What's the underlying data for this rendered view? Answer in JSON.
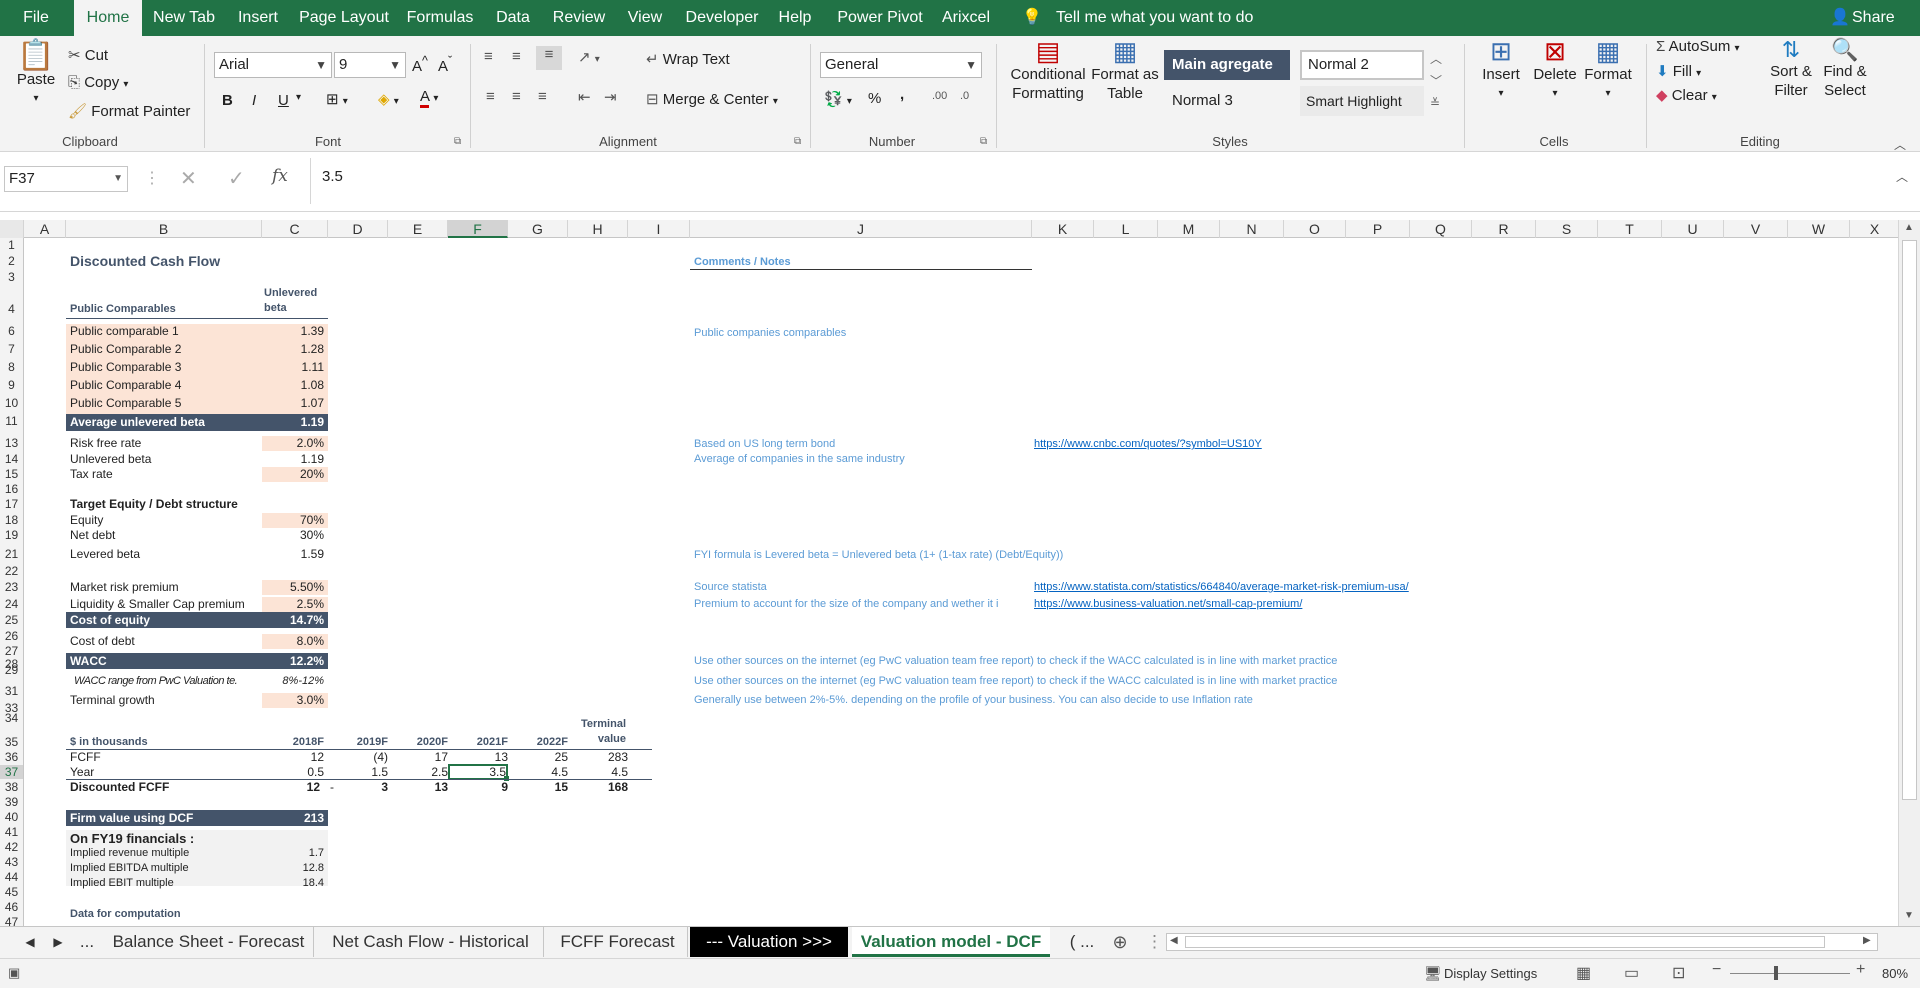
{
  "ribbon_tabs": [
    "File",
    "Home",
    "New Tab",
    "Insert",
    "Page Layout",
    "Formulas",
    "Data",
    "Review",
    "View",
    "Developer",
    "Help",
    "Power Pivot",
    "Arixcel"
  ],
  "tell_me": "Tell me what you want to do",
  "share": "Share",
  "clipboard": {
    "paste": "Paste",
    "cut": "Cut",
    "copy": "Copy",
    "format_painter": "Format Painter",
    "label": "Clipboard"
  },
  "font": {
    "name": "Arial",
    "size": "9",
    "label": "Font",
    "bold": "B",
    "italic": "I",
    "underline": "U"
  },
  "alignment": {
    "wrap": "Wrap Text",
    "merge": "Merge & Center",
    "label": "Alignment"
  },
  "number": {
    "format": "General",
    "label": "Number",
    "percent": "%",
    "comma": ","
  },
  "styles": {
    "cond_fmt": "Conditional Formatting",
    "format_table": "Format as Table",
    "label": "Styles",
    "s1": "Main agregate",
    "s2": "Normal 2",
    "s3": "Normal 3",
    "s4": "Smart Highlight"
  },
  "cells": {
    "insert": "Insert",
    "delete": "Delete",
    "format": "Format",
    "label": "Cells"
  },
  "editing": {
    "autosum": "AutoSum",
    "fill": "Fill",
    "clear": "Clear",
    "sort": "Sort & Filter",
    "find": "Find & Select",
    "label": "Editing"
  },
  "formula_bar": {
    "name_box": "F37",
    "value": "3.5",
    "fx": "fx"
  },
  "columns": [
    "A",
    "B",
    "C",
    "D",
    "E",
    "F",
    "G",
    "H",
    "I",
    "J",
    "K",
    "L",
    "M",
    "N",
    "O",
    "P",
    "Q",
    "R",
    "S",
    "T",
    "U",
    "V",
    "W",
    "X"
  ],
  "selected_column": "F",
  "rows": [
    "1",
    "2",
    "3",
    "4",
    "6",
    "7",
    "8",
    "9",
    "10",
    "11",
    "13",
    "14",
    "15",
    "16",
    "17",
    "18",
    "19",
    "21",
    "22",
    "23",
    "24",
    "25",
    "26",
    "27",
    "28",
    "29",
    "31",
    "33",
    "34",
    "35",
    "36",
    "37",
    "38",
    "39",
    "40",
    "41",
    "42",
    "43",
    "44",
    "45",
    "46",
    "47"
  ],
  "selected_row": "37",
  "sheet": {
    "title": "Discounted Cash Flow",
    "comments_header": "Comments / Notes",
    "unlevered_header": "Unlevered beta",
    "public_comparables": "Public Comparables",
    "comparables": [
      {
        "name": "Public comparable 1",
        "beta": "1.39"
      },
      {
        "name": "Public Comparable 2",
        "beta": "1.28"
      },
      {
        "name": "Public Comparable 3",
        "beta": "1.11"
      },
      {
        "name": "Public Comparable 4",
        "beta": "1.08"
      },
      {
        "name": "Public Comparable 5",
        "beta": "1.07"
      }
    ],
    "avg_beta_label": "Average unlevered beta",
    "avg_beta": "1.19",
    "risk_free_label": "Risk free rate",
    "risk_free": "2.0%",
    "unlevered_beta_label": "Unlevered beta",
    "unlevered_beta": "1.19",
    "tax_label": "Tax rate",
    "tax": "20%",
    "target_structure": "Target Equity / Debt structure",
    "equity_label": "Equity",
    "equity": "70%",
    "net_debt_label": "Net debt",
    "net_debt": "30%",
    "levered_beta_label": "Levered beta",
    "levered_beta": "1.59",
    "mrp_label": "Market risk premium",
    "mrp": "5.50%",
    "liq_label": "Liquidity & Smaller Cap premium",
    "liq": "2.5%",
    "coe_label": "Cost of equity",
    "coe": "14.7%",
    "cod_label": "Cost of debt",
    "cod": "8.0%",
    "wacc_label": "WACC",
    "wacc": "12.2%",
    "wacc_range_label": "WACC range from PwC Valuation te.",
    "wacc_range": "8%-12%",
    "tg_label": "Terminal growth",
    "tg": "3.0%",
    "thousands": "$ in thousands",
    "years": [
      "2018F",
      "2019F",
      "2020F",
      "2021F",
      "2022F"
    ],
    "terminal_header": "Terminal value",
    "fcff_label": "FCFF",
    "fcff": [
      "12",
      "(4)",
      "17",
      "13",
      "25",
      "283"
    ],
    "year_label": "Year",
    "year_vals": [
      "0.5",
      "1.5",
      "2.5",
      "3.5",
      "4.5",
      "4.5"
    ],
    "disc_label": "Discounted FCFF",
    "disc": [
      "12",
      "-",
      "3",
      "13",
      "9",
      "15",
      "168"
    ],
    "firm_value_label": "Firm value using DCF",
    "firm_value": "213",
    "fy19": "On FY19 financials :",
    "rev_mult_label": "Implied revenue multiple",
    "rev_mult": "1.7",
    "ebitda_mult_label": "Implied EBITDA multiple",
    "ebitda_mult": "12.8",
    "ebit_mult_label": "Implied EBIT multiple",
    "ebit_mult": "18.4",
    "data_comp": "Data for computation",
    "note_pub": "Public companies comparables",
    "note_bond": "Based on US long term bond",
    "link_bond": "https://www.cnbc.com/quotes/?symbol=US10Y",
    "note_avg": "Average of companies in the same industry",
    "note_fyi": "FYI formula is Levered beta =  Unlevered beta (1+ (1-tax rate) (Debt/Equity))",
    "note_statista": "Source statista",
    "link_statista": "https://www.statista.com/statistics/664840/average-market-risk-premium-usa/",
    "note_premium": "Premium to account for the size of the company and wether it i",
    "link_premium": "https://www.business-valuation.net/small-cap-premium/",
    "note_other1": "Use other sources on the internet (eg PwC valuation team free report) to check if the WACC calculated is in line with market practice",
    "note_other2": "Use other sources on the internet (eg PwC valuation team free report) to check if the WACC calculated is in line with market practice",
    "note_general": "Generally use between 2%-5%. depending on the profile of your business. You can also decide to use Inflation rate"
  },
  "sheet_tabs": [
    "...",
    "Balance Sheet - Forecast",
    "Net Cash Flow - Historical",
    "FCFF Forecast",
    "--- Valuation >>>",
    "Valuation model - DCF",
    "( ..."
  ],
  "status": {
    "display_settings": "Display Settings",
    "zoom": "80%"
  }
}
